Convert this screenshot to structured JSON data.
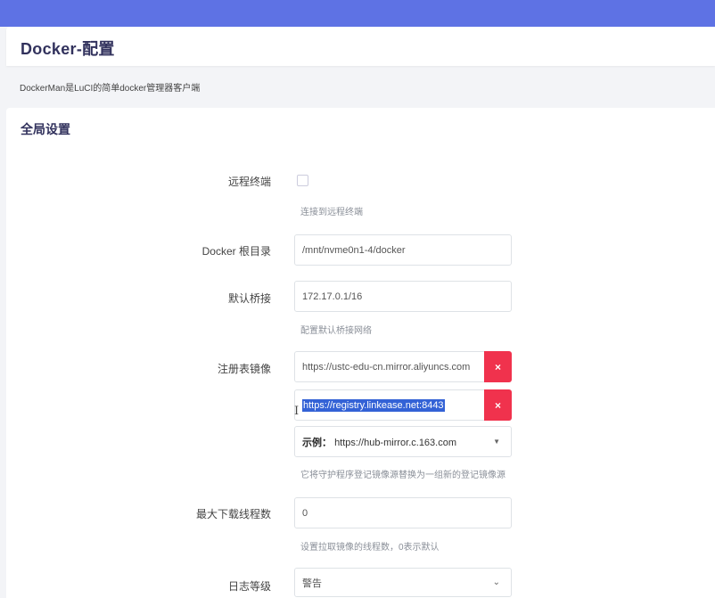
{
  "header": {
    "title": "Docker-配置"
  },
  "description": "DockerMan是LuCI的简单docker管理器客户端",
  "section": {
    "title": "全局设置"
  },
  "remote_terminal": {
    "label": "远程终端",
    "hint": "连接到远程终端",
    "checked": false
  },
  "docker_root": {
    "label": "Docker 根目录",
    "value": "/mnt/nvme0n1-4/docker"
  },
  "default_bridge": {
    "label": "默认桥接",
    "value": "172.17.0.1/16",
    "hint": "配置默认桥接网络"
  },
  "registry_mirrors": {
    "label": "注册表镜像",
    "items": [
      {
        "value": "https://ustc-edu-cn.mirror.aliyuncs.com"
      },
      {
        "value": "https://registry.linkease.net:8443"
      }
    ],
    "delete_label": "×",
    "placeholder_prefix": "示例：",
    "placeholder_value": "https://hub-mirror.c.163.com",
    "hint": "它将守护程序登记镜像源替换为一组新的登记镜像源"
  },
  "max_download_threads": {
    "label": "最大下载线程数",
    "value": "0",
    "hint": "设置拉取镜像的线程数，0表示默认"
  },
  "log_level": {
    "label": "日志等级",
    "value": "警告"
  },
  "icons": {
    "delete": "close-icon",
    "caret": "caret-down-icon",
    "chevron": "chevron-down-icon",
    "cursor": "text-cursor-icon"
  },
  "colors": {
    "topbar": "#5e72e4",
    "delete_button": "#f0324d",
    "selection": "#3362d6"
  }
}
